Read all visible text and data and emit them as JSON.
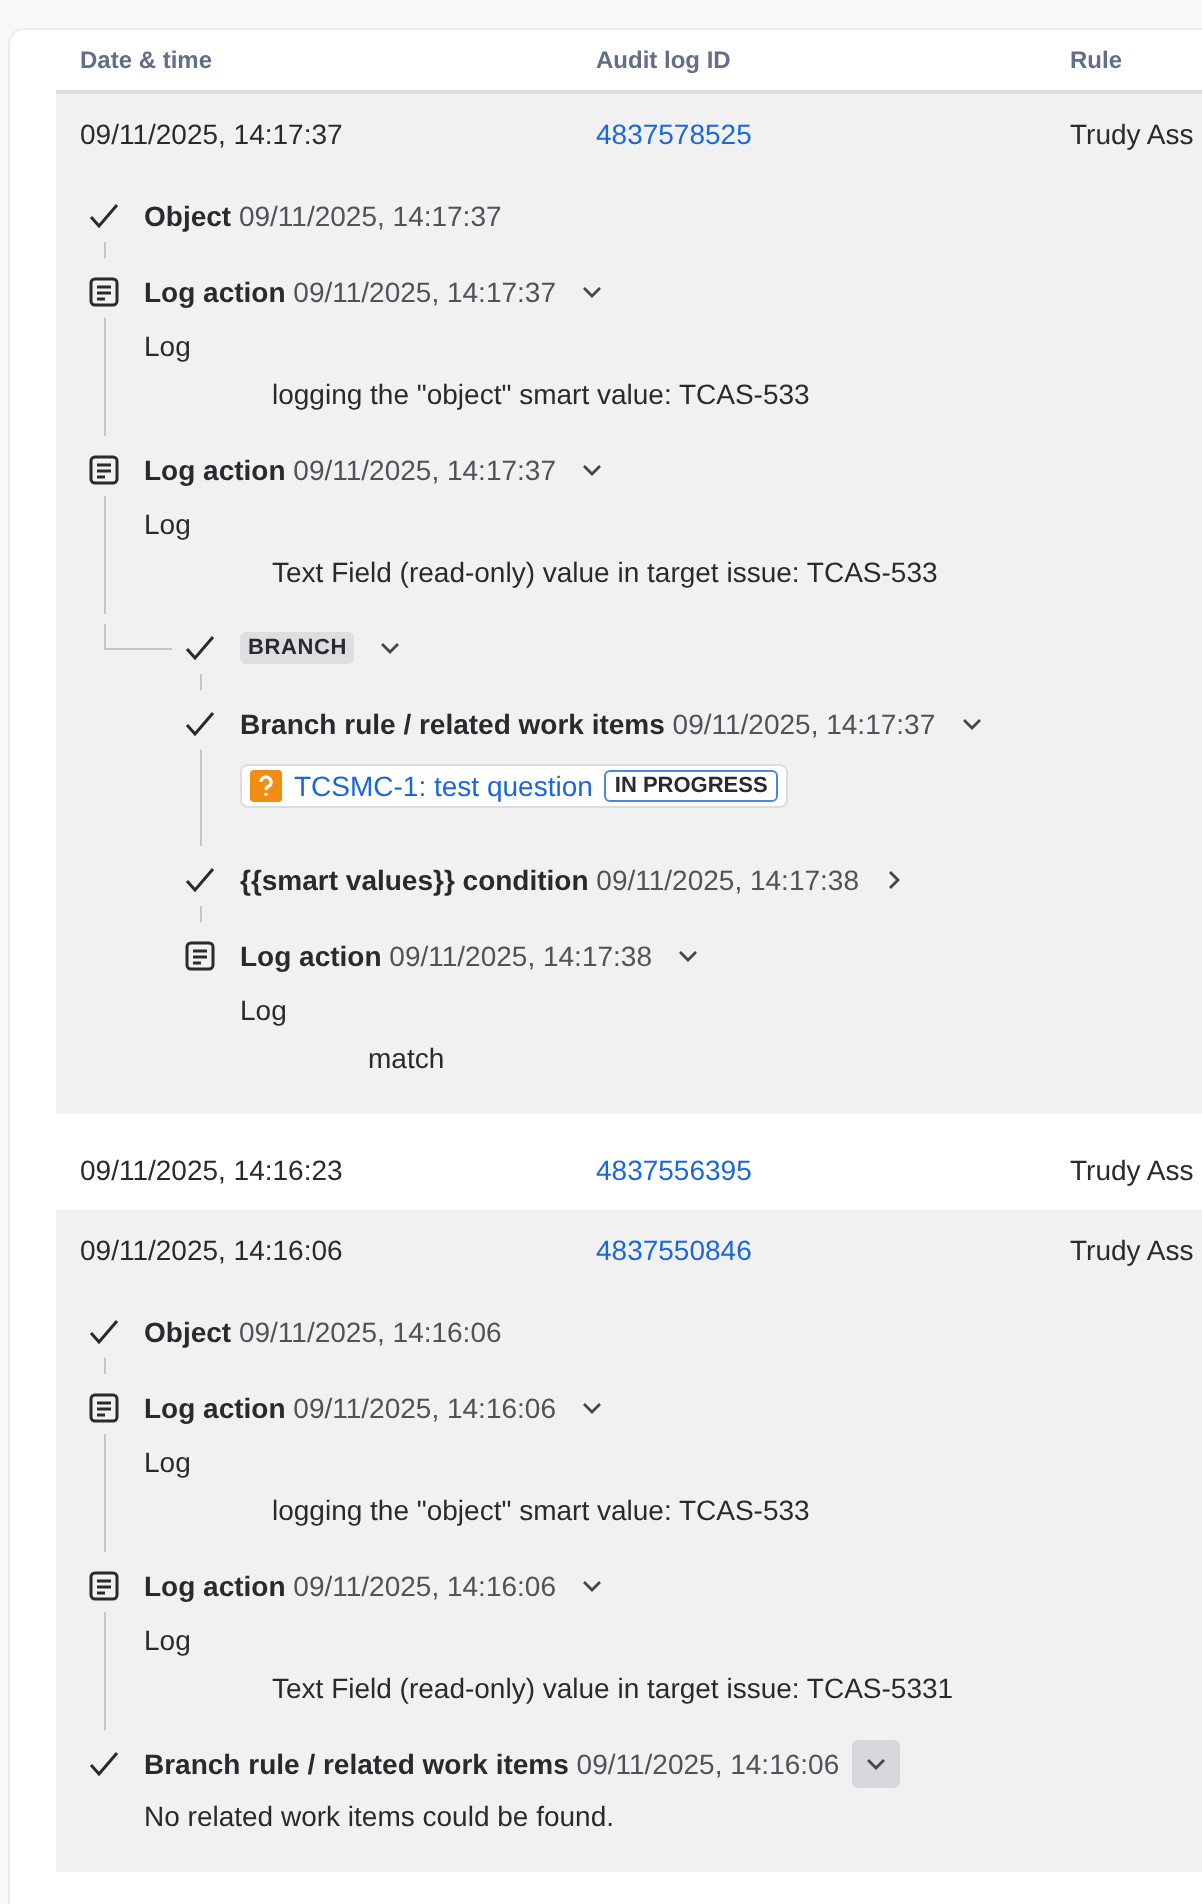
{
  "table": {
    "columns": [
      "Date & time",
      "Audit log ID",
      "Rule"
    ],
    "rows": [
      {
        "date": "09/11/2025, 14:17:37",
        "audit_id": "4837578525",
        "rule": "Trudy Ass",
        "expanded": true,
        "steps": [
          {
            "kind": "check",
            "title": "Object",
            "time": "09/11/2025, 14:17:37"
          },
          {
            "kind": "log",
            "title": "Log action",
            "time": "09/11/2025, 14:17:37",
            "expanded": true,
            "highlighted": false,
            "log_label": "Log",
            "message": "logging the \"object\" smart value: TCAS-533"
          },
          {
            "kind": "log",
            "title": "Log action",
            "time": "09/11/2025, 14:17:37",
            "expanded": true,
            "highlighted": false,
            "log_label": "Log",
            "message": "Text Field (read-only) value in target issue: TCAS-533"
          },
          {
            "kind": "branch",
            "tag": "BRANCH",
            "expanded": true,
            "highlighted": false,
            "children": [
              {
                "kind": "check",
                "title": "Branch rule / related work items",
                "time": "09/11/2025, 14:17:37",
                "expanded": true,
                "highlighted": false,
                "work_item": {
                  "title": "TCSMC-1: test question",
                  "status": "IN PROGRESS"
                }
              },
              {
                "kind": "check",
                "title": "{{smart values}} condition",
                "time": "09/11/2025, 14:17:38",
                "expanded": false,
                "highlighted": false
              },
              {
                "kind": "log",
                "title": "Log action",
                "time": "09/11/2025, 14:17:38",
                "expanded": true,
                "highlighted": false,
                "log_label": "Log",
                "message": "match"
              }
            ]
          }
        ]
      },
      {
        "date": "09/11/2025, 14:16:23",
        "audit_id": "4837556395",
        "rule": "Trudy Ass",
        "expanded": false
      },
      {
        "date": "09/11/2025, 14:16:06",
        "audit_id": "4837550846",
        "rule": "Trudy Ass",
        "expanded": true,
        "steps": [
          {
            "kind": "check",
            "title": "Object",
            "time": "09/11/2025, 14:16:06"
          },
          {
            "kind": "log",
            "title": "Log action",
            "time": "09/11/2025, 14:16:06",
            "expanded": true,
            "highlighted": false,
            "log_label": "Log",
            "message": "logging the \"object\" smart value: TCAS-533"
          },
          {
            "kind": "log",
            "title": "Log action",
            "time": "09/11/2025, 14:16:06",
            "expanded": true,
            "highlighted": false,
            "log_label": "Log",
            "message": "Text Field (read-only) value in target issue: TCAS-5331"
          },
          {
            "kind": "check",
            "title": "Branch rule / related work items",
            "time": "09/11/2025, 14:16:06",
            "expanded": true,
            "highlighted": true,
            "note": "No related work items could be found."
          }
        ]
      }
    ]
  }
}
